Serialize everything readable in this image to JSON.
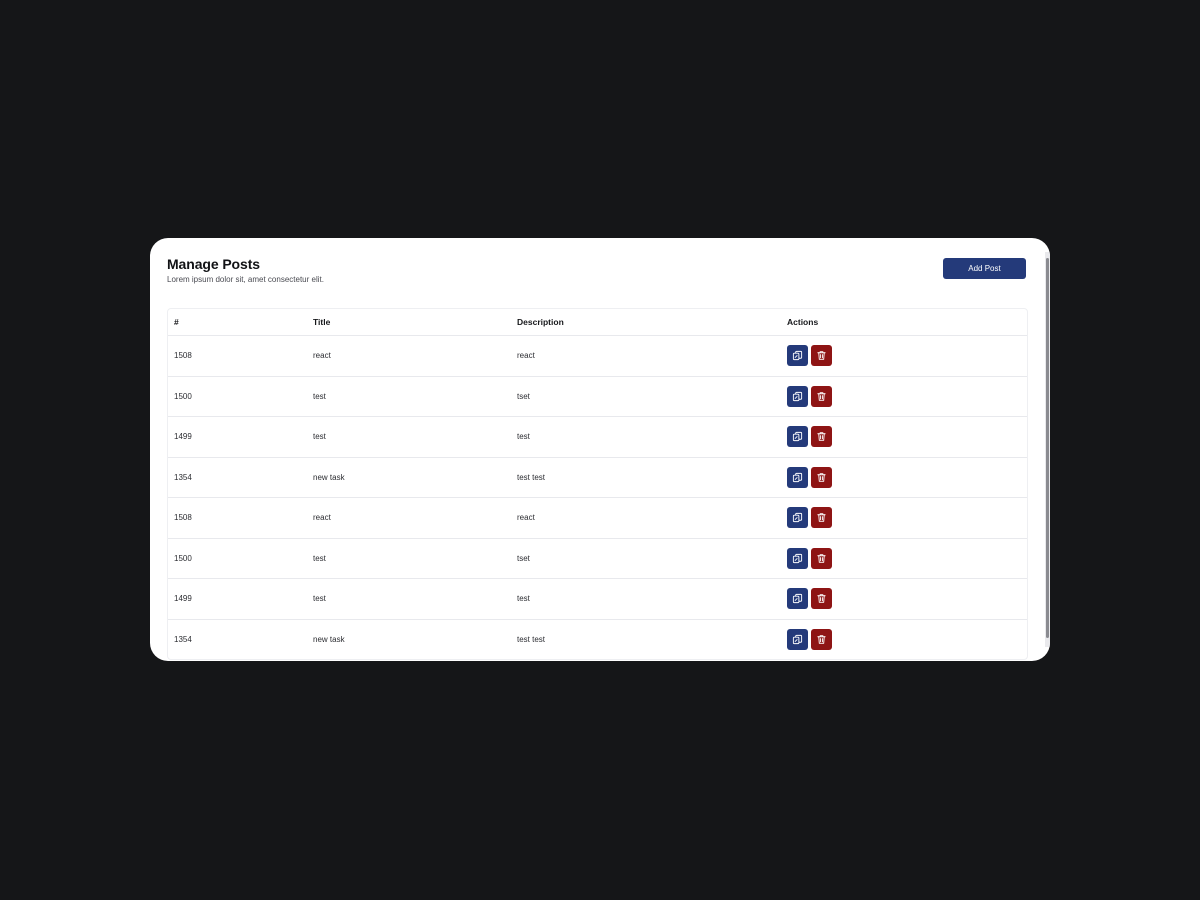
{
  "header": {
    "title": "Manage Posts",
    "subtitle": "Lorem ipsum dolor sit, amet consectetur elit.",
    "add_button_label": "Add Post"
  },
  "table": {
    "columns": [
      "#",
      "Title",
      "Description",
      "Actions"
    ],
    "rows": [
      {
        "id": "1508",
        "title": "react",
        "description": "react"
      },
      {
        "id": "1500",
        "title": "test",
        "description": "tset"
      },
      {
        "id": "1499",
        "title": "test",
        "description": "test"
      },
      {
        "id": "1354",
        "title": "new task",
        "description": "test test"
      },
      {
        "id": "1508",
        "title": "react",
        "description": "react"
      },
      {
        "id": "1500",
        "title": "test",
        "description": "tset"
      },
      {
        "id": "1499",
        "title": "test",
        "description": "test"
      },
      {
        "id": "1354",
        "title": "new task",
        "description": "test test"
      }
    ],
    "row_actions": [
      {
        "name": "edit",
        "icon": "edit-copy-icon",
        "color": "#243a7a"
      },
      {
        "name": "delete",
        "icon": "trash-icon",
        "color": "#8e1414"
      }
    ]
  },
  "colors": {
    "background": "#151618",
    "card": "#ffffff",
    "primary": "#243a7a",
    "danger": "#8e1414"
  }
}
